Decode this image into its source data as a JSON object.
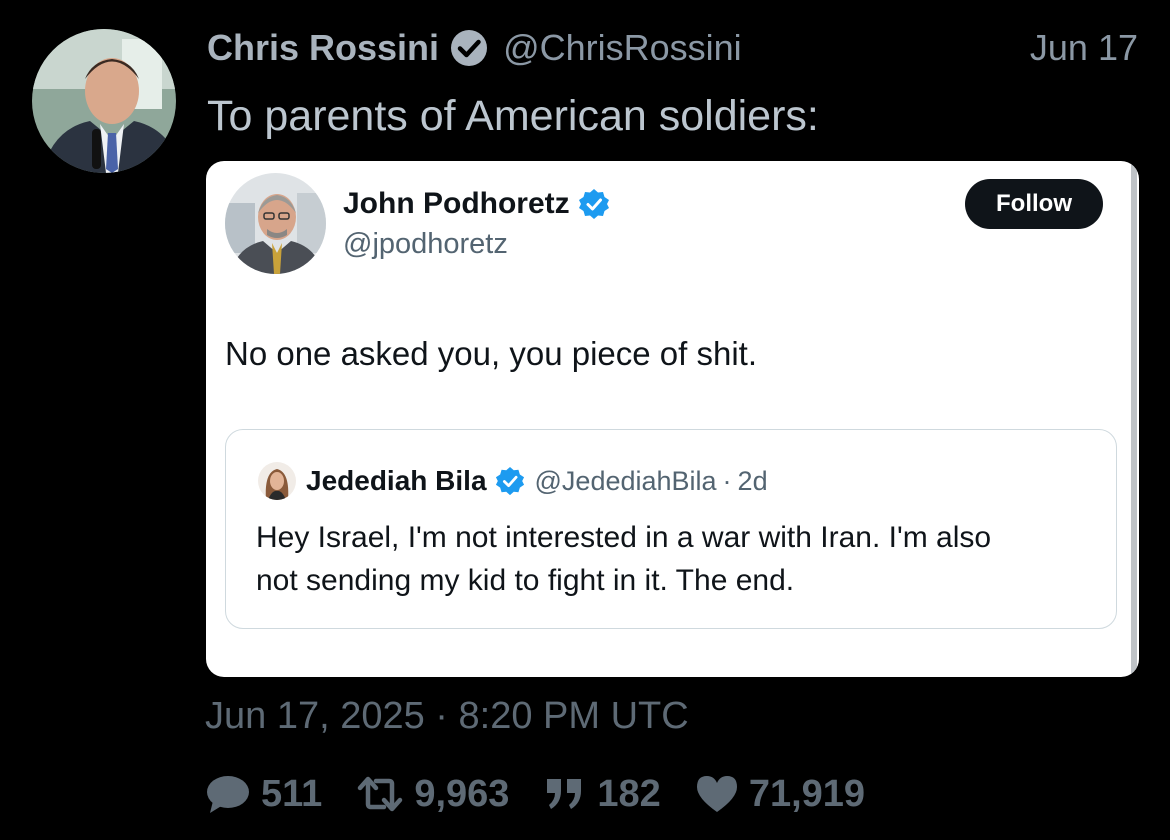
{
  "tweet": {
    "author": {
      "name": "Chris Rossini",
      "handle": "@ChrisRossini",
      "verified": true
    },
    "date_short": "Jun 17",
    "text": "To parents of American soldiers:",
    "timestamp": "Jun 17, 2025 · 8:20 PM UTC",
    "stats": {
      "replies": "511",
      "retweets": "9,963",
      "quotes": "182",
      "likes": "71,919"
    }
  },
  "embedded": {
    "author": {
      "name": "John Podhoretz",
      "handle": "@jpodhoretz",
      "verified": true
    },
    "follow_label": "Follow",
    "text": "No one asked you, you piece of shit.",
    "quoted": {
      "author": {
        "name": "Jedediah Bila",
        "handle": "@JedediahBila",
        "verified": true
      },
      "separator": "·",
      "time": "2d",
      "text_lines": [
        "Hey Israel, I'm not interested in a war with Iran. I'm also",
        "not sending my kid to fight in it. The end."
      ]
    }
  },
  "icons": {
    "verified": "verified-badge-icon",
    "reply": "reply-icon",
    "retweet": "retweet-icon",
    "quote": "quote-icon",
    "like": "heart-icon"
  },
  "colors": {
    "background": "#000000",
    "verified_dark": "#a9b3bd",
    "verified_blue": "#1d9bf0",
    "follow_button": "#0f1419",
    "muted_text": "#5e6a75"
  }
}
